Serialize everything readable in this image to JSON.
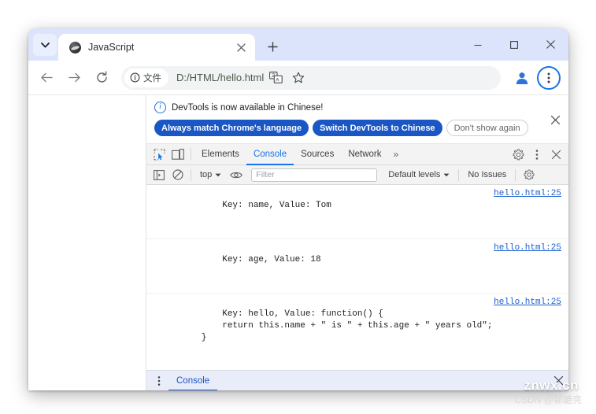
{
  "browser": {
    "tab_search_icon": "chevron-down-icon",
    "tab": {
      "favicon": "javascript-globe-icon",
      "title": "JavaScript",
      "close_icon": "close-icon"
    },
    "new_tab_icon": "plus-icon",
    "window_controls": {
      "minimize": "minimize-icon",
      "maximize": "maximize-icon",
      "close": "close-icon"
    },
    "nav": {
      "back_icon": "arrow-left-icon",
      "forward_icon": "arrow-right-icon",
      "reload_icon": "reload-icon"
    },
    "omnibox": {
      "security_icon": "info-circle-icon",
      "scheme_label": "文件",
      "url": "D:/HTML/hello.html",
      "translate_icon": "translate-icon",
      "bookmark_icon": "star-icon"
    },
    "profile_icon": "account-avatar-icon",
    "menu_icon": "three-dot-menu-icon"
  },
  "devtools": {
    "infobar": {
      "icon": "info-circle-icon",
      "message": "DevTools is now available in Chinese!",
      "buttons": [
        {
          "label": "Always match Chrome's language",
          "style": "primary"
        },
        {
          "label": "Switch DevTools to Chinese",
          "style": "primary"
        },
        {
          "label": "Don't show again",
          "style": "ghost"
        }
      ],
      "close_icon": "close-icon"
    },
    "tabbar": {
      "inspect_icon": "inspect-element-icon",
      "device_icon": "device-toolbar-icon",
      "tabs": [
        {
          "label": "Elements",
          "active": false
        },
        {
          "label": "Console",
          "active": true
        },
        {
          "label": "Sources",
          "active": false
        },
        {
          "label": "Network",
          "active": false
        }
      ],
      "overflow_label": "»",
      "settings_icon": "gear-icon",
      "menu_icon": "three-dot-menu-icon",
      "close_icon": "close-icon"
    },
    "console_toolbar": {
      "sidebar_icon": "console-sidebar-icon",
      "clear_icon": "clear-console-icon",
      "context_label": "top",
      "context_caret": "caret-down-icon",
      "eye_icon": "live-expression-eye-icon",
      "filter_placeholder": "Filter",
      "filter_value": "",
      "levels_label": "Default levels",
      "levels_caret": "caret-down-icon",
      "issues_label": "No Issues",
      "settings_icon": "gear-icon"
    },
    "console_messages": [
      {
        "text": "Key: name, Value: Tom",
        "source": "hello.html:25"
      },
      {
        "text": "Key: age, Value: 18",
        "source": "hello.html:25"
      },
      {
        "text": "Key: hello, Value: function() {\n            return this.name + \" is \" + this.age + \" years old\";\n        }",
        "source": "hello.html:25"
      }
    ],
    "console_prompt": ">",
    "drawer": {
      "menu_icon": "three-dot-menu-icon",
      "tab_label": "Console",
      "close_icon": "close-icon"
    }
  },
  "watermarks": {
    "primary": "znwx.cn",
    "secondary": "CSDN @郭螗亮"
  },
  "colors": {
    "accent": "#1a73e8",
    "tabstrip": "#dce4fb",
    "drawer": "#e8edf9",
    "link": "#1a5fd0"
  }
}
